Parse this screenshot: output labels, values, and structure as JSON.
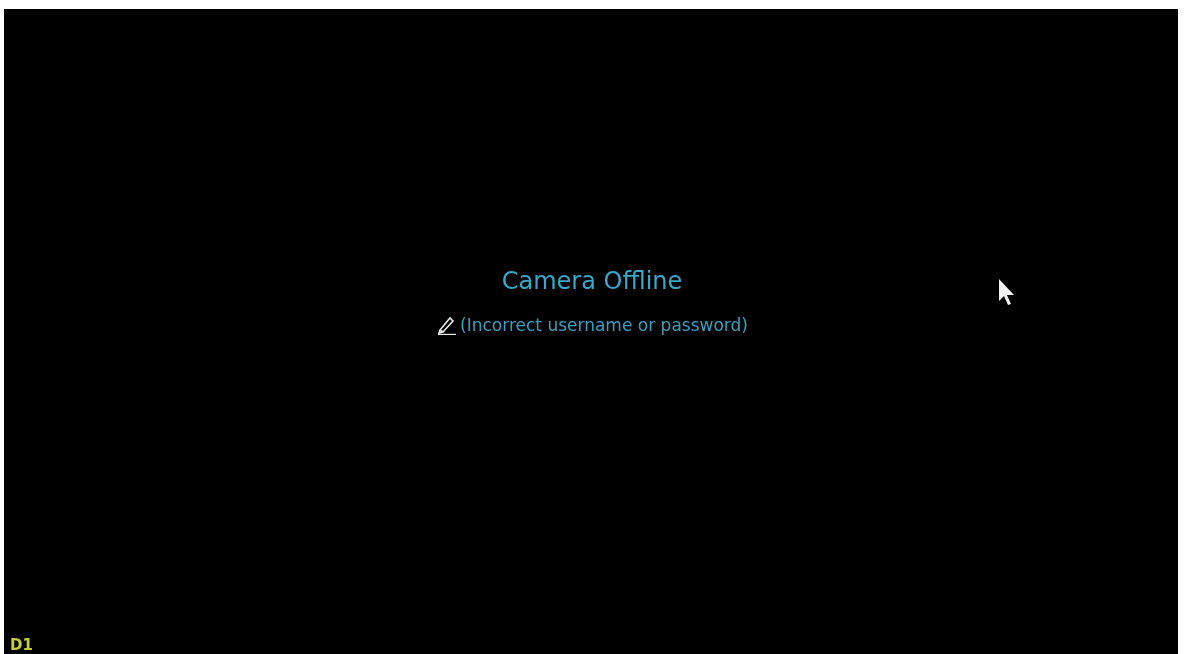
{
  "status": {
    "title": "Camera Offline",
    "message": "(Incorrect username or password)"
  },
  "channel": {
    "label": "D1"
  }
}
